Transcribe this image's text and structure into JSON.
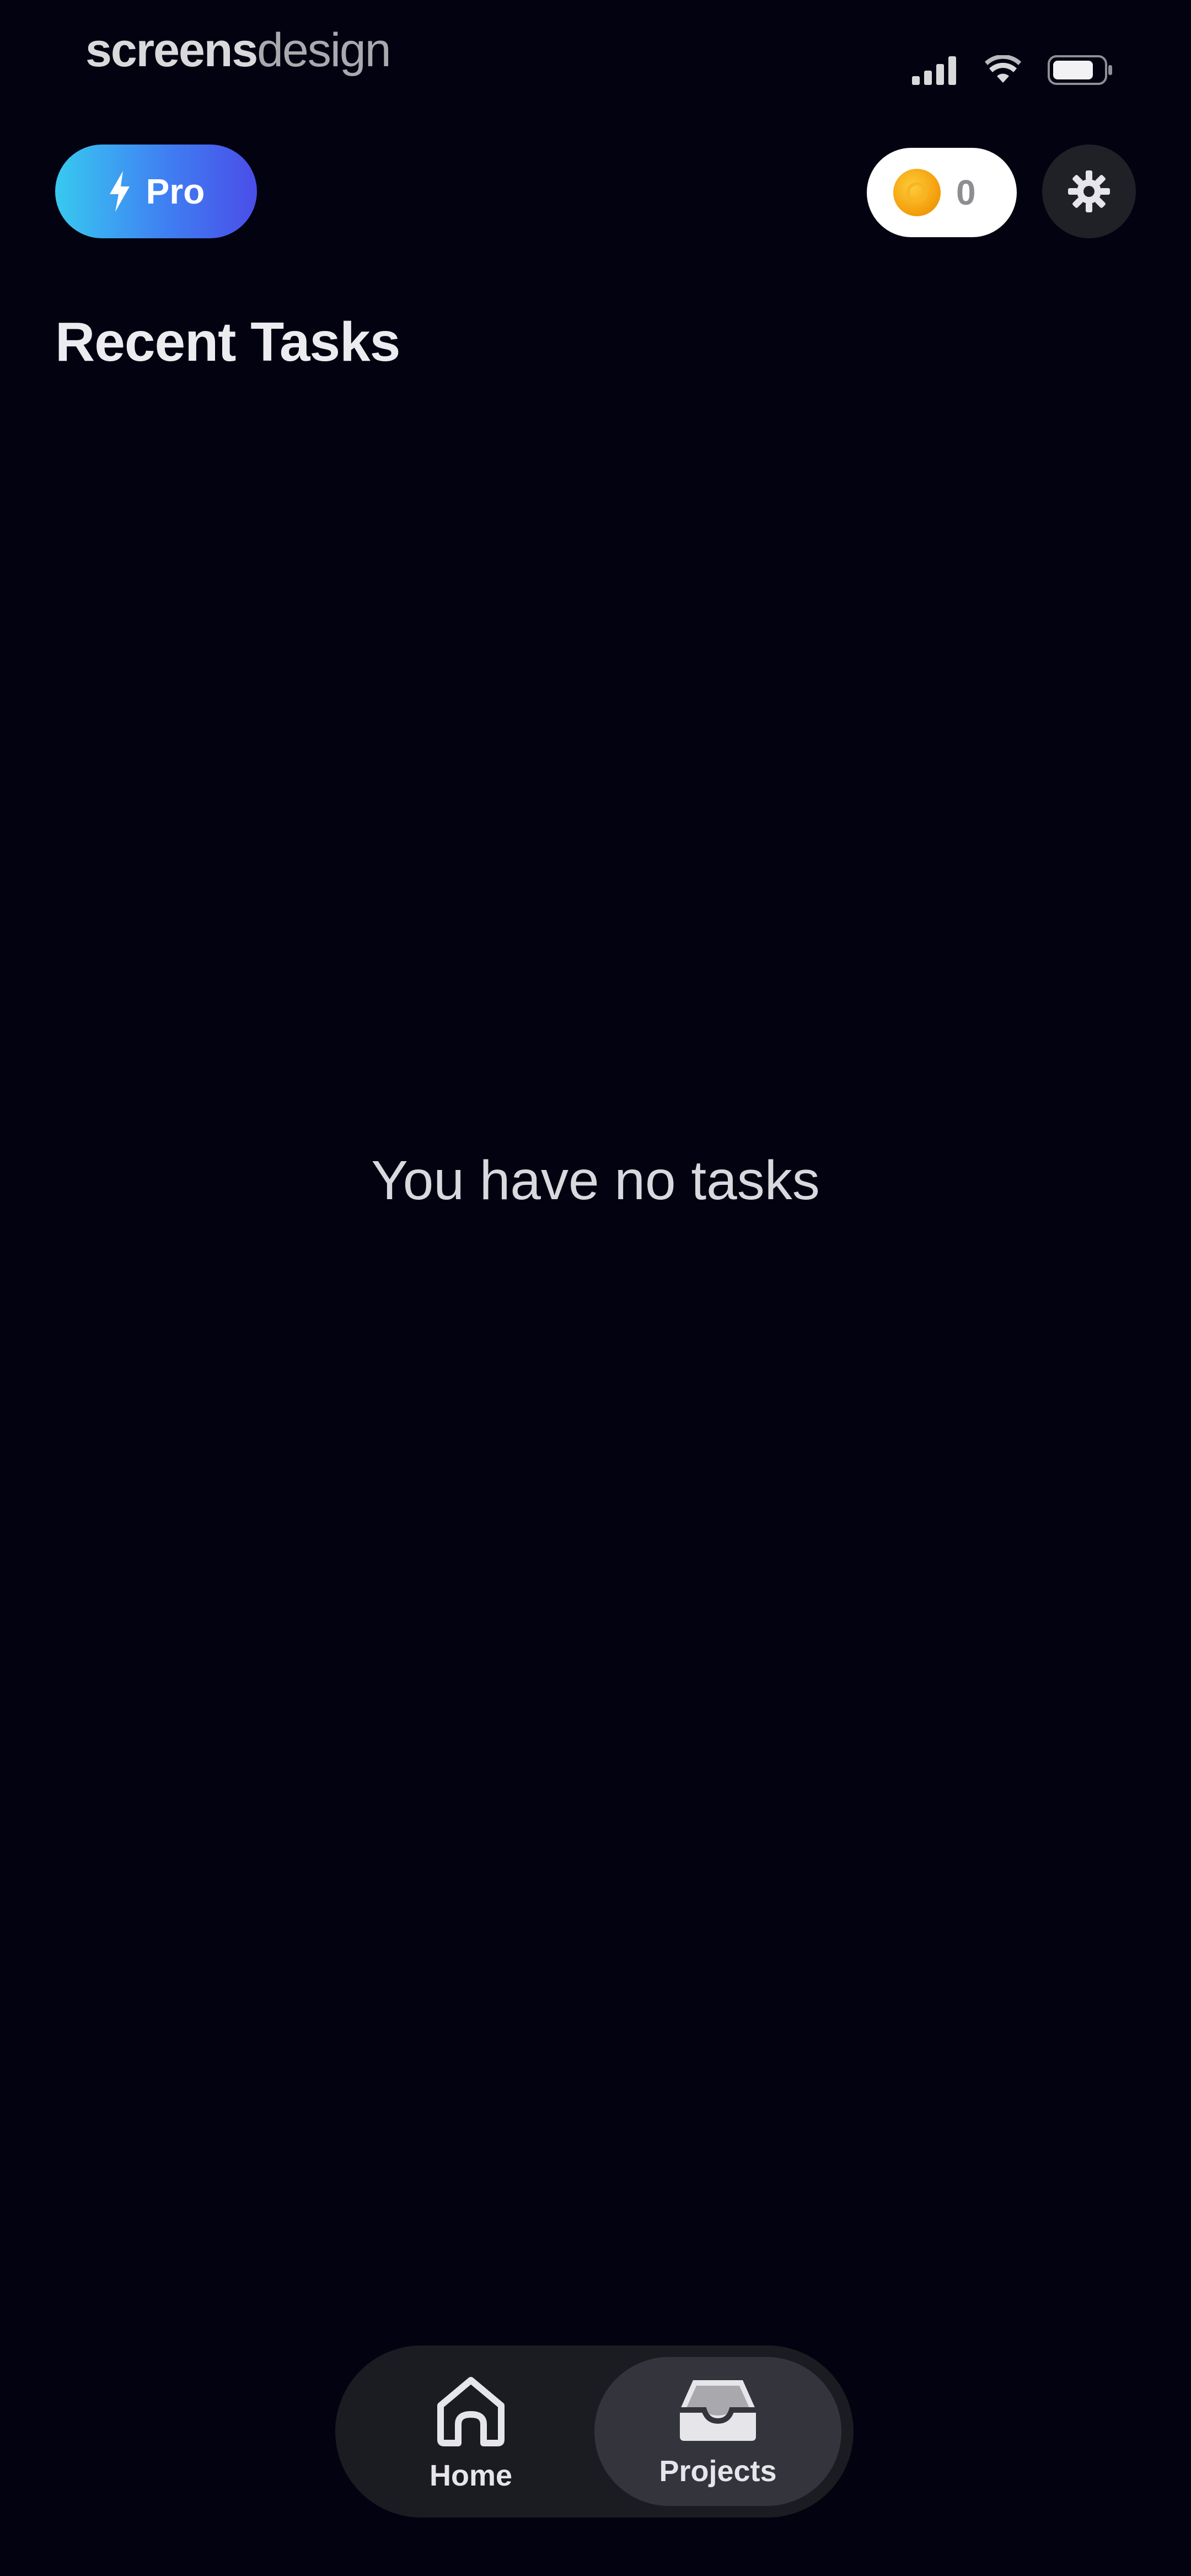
{
  "status_bar": {
    "watermark_bold": "screens",
    "watermark_light": "design",
    "icons": [
      "signal-icon",
      "wifi-icon",
      "battery-icon"
    ]
  },
  "header": {
    "pro_label": "Pro",
    "pro_icon": "bolt-icon",
    "coins_icon": "coin-icon",
    "coins_value": "0",
    "settings_icon": "gear-icon"
  },
  "main": {
    "section_title": "Recent Tasks",
    "empty_message": "You have no tasks"
  },
  "tab_bar": {
    "tabs": [
      {
        "label": "Home",
        "icon": "home-icon",
        "active": false
      },
      {
        "label": "Projects",
        "icon": "inbox-icon",
        "active": true
      }
    ]
  },
  "colors": {
    "background": "#030210",
    "pro_gradient_start": "#38c9f0",
    "pro_gradient_end": "#4a4de8",
    "coin": "#f4a20e",
    "tab_bar": "#1b1b22",
    "tab_active": "#34343d"
  }
}
